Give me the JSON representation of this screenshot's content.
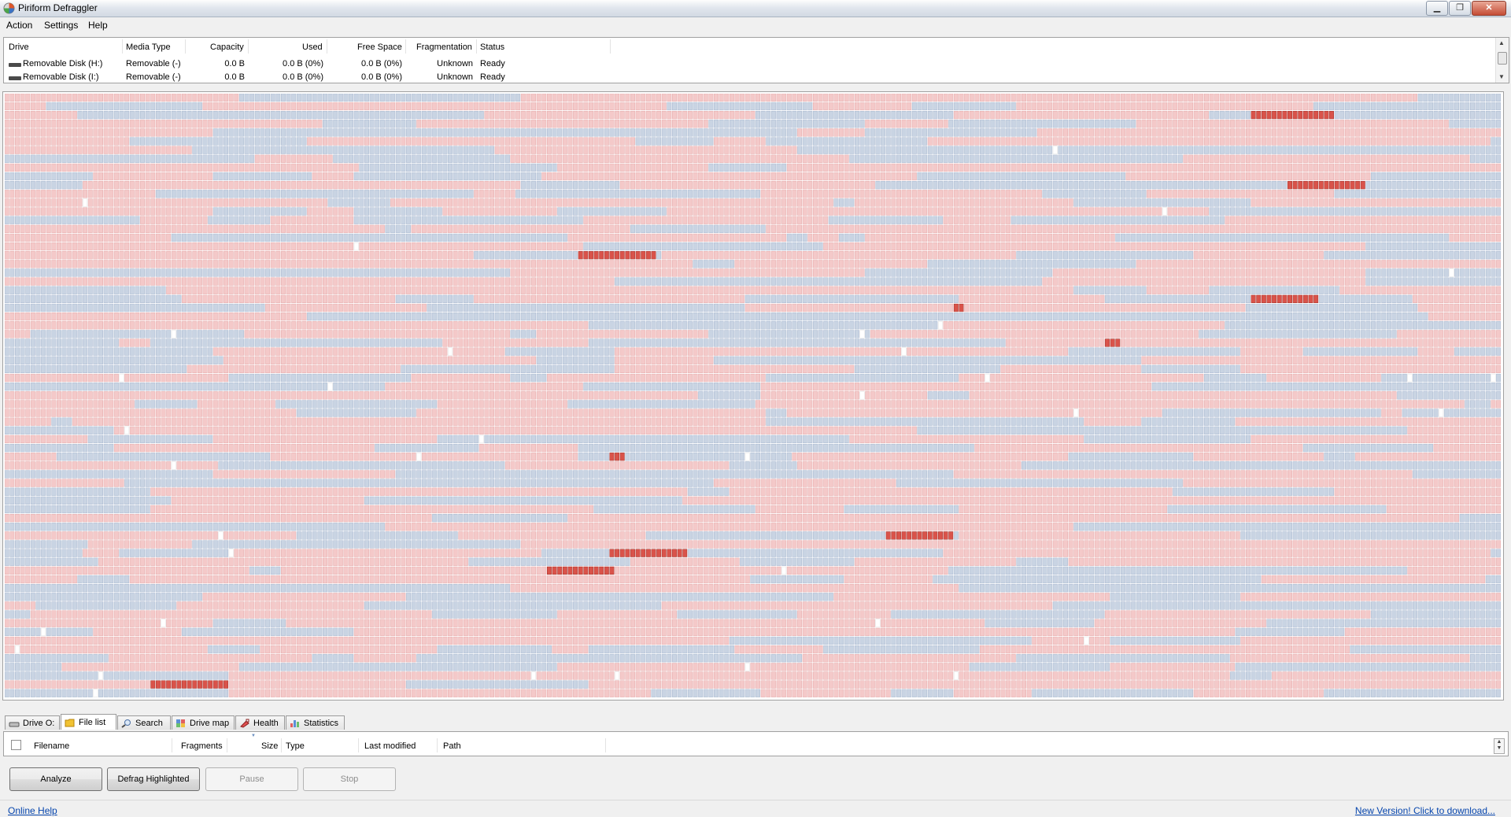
{
  "window": {
    "title": "Piriform Defraggler",
    "minimize_glyph": "▁",
    "maximize_glyph": "❐",
    "close_glyph": "✕"
  },
  "menu": [
    "Action",
    "Settings",
    "Help"
  ],
  "drives": {
    "columns": [
      "Drive",
      "Media Type",
      "Capacity",
      "Used",
      "Free Space",
      "Fragmentation",
      "Status"
    ],
    "rows": [
      {
        "drive": "Removable Disk (H:)",
        "media": "Removable (-)",
        "capacity": "0.0 B",
        "used": "0.0 B (0%)",
        "free": "0.0 B (0%)",
        "fragmentation": "Unknown",
        "status": "Ready"
      },
      {
        "drive": "Removable Disk (I:)",
        "media": "Removable (-)",
        "capacity": "0.0 B",
        "used": "0.0 B (0%)",
        "free": "0.0 B (0%)",
        "fragmentation": "Unknown",
        "status": "Ready"
      }
    ]
  },
  "disk_map": {
    "columns": 287,
    "rows": 69,
    "colors": {
      "used": "#f4c9c9",
      "used_border": "#e5abab",
      "free": "#c9d4e3",
      "free_border": "#a9b8cf",
      "fragmented": "#d9534a",
      "fragmented_border": "#a32f28",
      "empty": "#ffffff"
    },
    "fragmented_segments": [
      {
        "row": 2,
        "start": 239,
        "length": 16
      },
      {
        "row": 10,
        "start": 246,
        "length": 15
      },
      {
        "row": 18,
        "start": 110,
        "length": 15
      },
      {
        "row": 23,
        "start": 239,
        "length": 13
      },
      {
        "row": 24,
        "start": 182,
        "length": 2
      },
      {
        "row": 28,
        "start": 211,
        "length": 3
      },
      {
        "row": 41,
        "start": 116,
        "length": 3
      },
      {
        "row": 50,
        "start": 169,
        "length": 13
      },
      {
        "row": 52,
        "start": 116,
        "length": 15
      },
      {
        "row": 54,
        "start": 104,
        "length": 13
      },
      {
        "row": 67,
        "start": 28,
        "length": 15
      }
    ]
  },
  "tabs": [
    {
      "label": "Drive O:",
      "icon": "drive-icon"
    },
    {
      "label": "File list",
      "icon": "folder-icon"
    },
    {
      "label": "Search",
      "icon": "magnifier-icon"
    },
    {
      "label": "Drive map",
      "icon": "drive-map-icon"
    },
    {
      "label": "Health",
      "icon": "health-icon"
    },
    {
      "label": "Statistics",
      "icon": "bar-chart-icon"
    }
  ],
  "active_tab": "File list",
  "file_list": {
    "columns": [
      "Filename",
      "Fragments",
      "Size",
      "Type",
      "Last modified",
      "Path"
    ]
  },
  "buttons": {
    "analyze": "Analyze",
    "defrag_highlighted": "Defrag Highlighted",
    "pause": "Pause",
    "stop": "Stop"
  },
  "footer": {
    "online_help": "Online Help",
    "new_version": "New Version! Click to download..."
  }
}
